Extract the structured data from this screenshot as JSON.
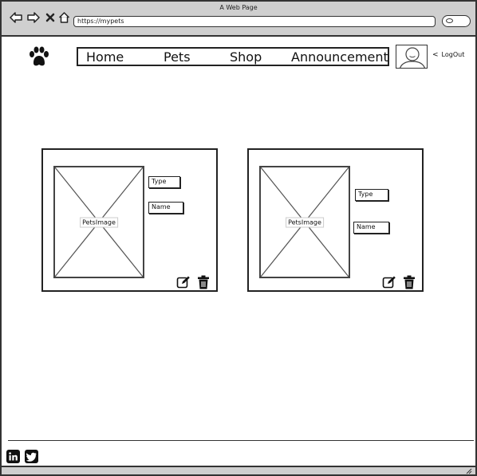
{
  "browser": {
    "title": "A Web Page",
    "url": "https://mypets",
    "nav_icons": [
      "back-arrow-icon",
      "forward-arrow-icon",
      "close-icon",
      "home-icon"
    ],
    "search_icon": "search-icon"
  },
  "header": {
    "logo_icon": "paw-icon",
    "nav": [
      {
        "label": "Home"
      },
      {
        "label": "Pets"
      },
      {
        "label": "Shop"
      },
      {
        "label": "Announcement"
      }
    ],
    "avatar_icon": "user-avatar-icon",
    "logout_label": "LogOut"
  },
  "cards": [
    {
      "image_label": "PetsImage",
      "type_label": "Type",
      "name_label": "Name",
      "edit_icon": "edit-icon",
      "delete_icon": "trash-icon"
    },
    {
      "image_label": "PetsImage",
      "type_label": "Type",
      "name_label": "Name",
      "edit_icon": "edit-icon",
      "delete_icon": "trash-icon"
    }
  ],
  "footer": {
    "social": [
      "linkedin-icon",
      "twitter-icon"
    ]
  }
}
